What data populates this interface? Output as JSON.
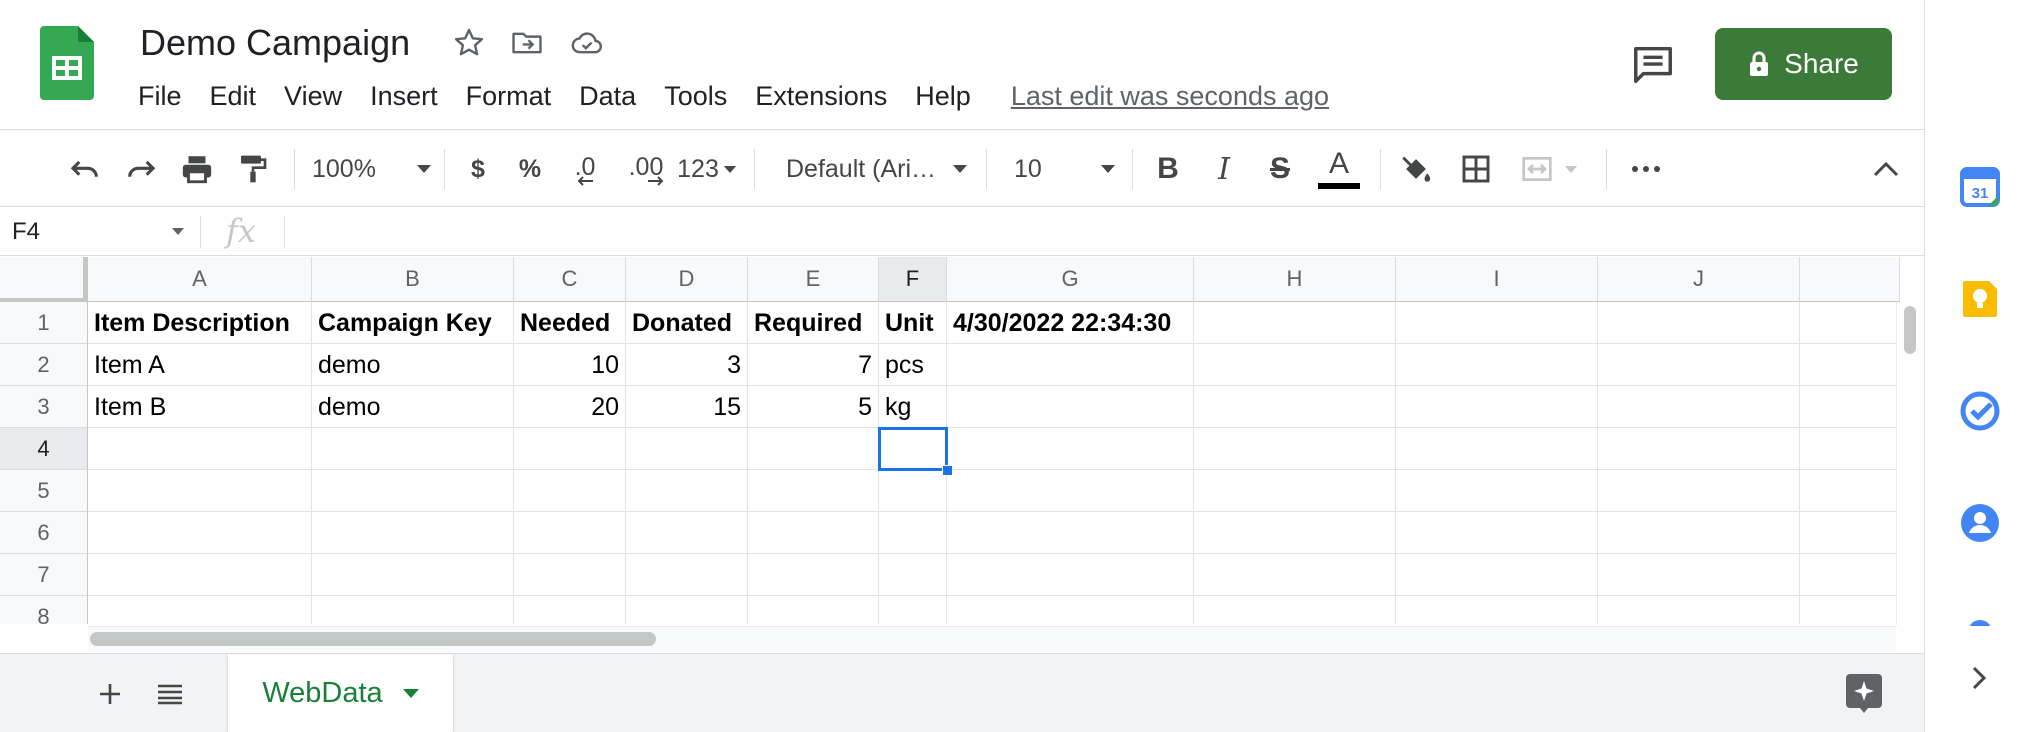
{
  "window": {
    "doc_title": "Demo Campaign",
    "last_edit": "Last edit was seconds ago",
    "share_label": "Share"
  },
  "menu": [
    "File",
    "Edit",
    "View",
    "Insert",
    "Format",
    "Data",
    "Tools",
    "Extensions",
    "Help"
  ],
  "toolbar": {
    "zoom": "100%",
    "currency": "$",
    "percent": "%",
    "decrease_decimal": ".0",
    "increase_decimal": ".00",
    "more_formats": "123",
    "font": "Default (Ari…",
    "font_size": "10",
    "bold": "B",
    "italic": "I",
    "strike": "S",
    "text_color": "A",
    "text_color_value": "#000000"
  },
  "formula_bar": {
    "name_box": "F4",
    "fx": "fx",
    "value": ""
  },
  "columns": [
    "A",
    "B",
    "C",
    "D",
    "E",
    "F",
    "G",
    "H",
    "I",
    "J"
  ],
  "rows": [
    "1",
    "2",
    "3",
    "4",
    "5",
    "6",
    "7",
    "8"
  ],
  "cells": {
    "r1": {
      "a": "Item Description",
      "b": "Campaign Key",
      "c": "Needed",
      "d": "Donated",
      "e": "Required",
      "f": "Unit",
      "g": "4/30/2022 22:34:30"
    },
    "r2": {
      "a": "Item A",
      "b": "demo",
      "c": "10",
      "d": "3",
      "e": "7",
      "f": "pcs"
    },
    "r3": {
      "a": "Item B",
      "b": "demo",
      "c": "20",
      "d": "15",
      "e": "5",
      "f": "kg"
    }
  },
  "selected_cell": "F4",
  "sheets": [
    {
      "name": "WebData",
      "active": true
    }
  ],
  "colors": {
    "share": "#3c7a3a",
    "active_tab": "#188038",
    "selection": "#1a73e8"
  },
  "side_panel": [
    "calendar-icon",
    "keep-icon",
    "tasks-icon",
    "contacts-icon"
  ]
}
